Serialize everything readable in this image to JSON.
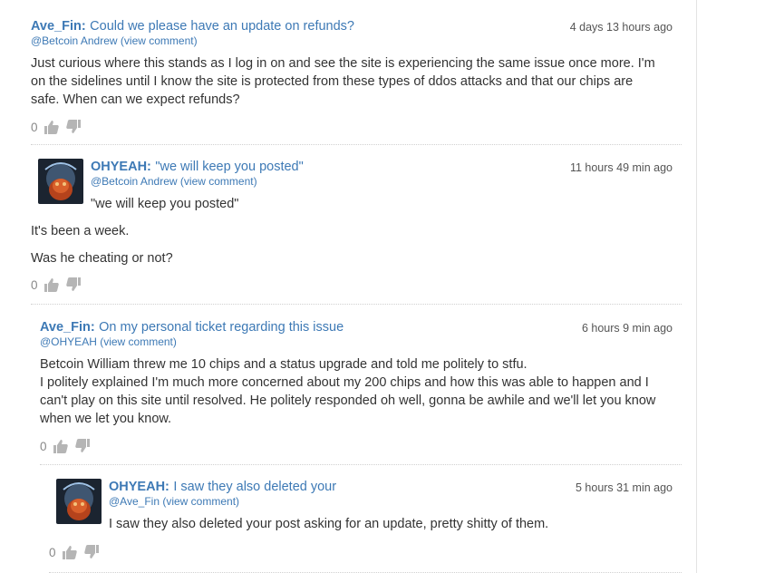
{
  "comments": [
    {
      "author": "Ave_Fin:",
      "subject": "Could we please have an update on refunds?",
      "mention": "@Betcoin Andrew",
      "view_link": "(view comment)",
      "time": "4 days 13 hours ago",
      "quote": "",
      "paragraphs": [
        "Just curious where this stands as I log in on and see the site is experiencing the same issue once more. I'm on the sidelines until I know the site is protected from these types of ddos attacks and that our chips are safe. When can we expect refunds?"
      ],
      "votes": "0"
    },
    {
      "author": "OHYEAH:",
      "subject": "\"we will keep you posted\"",
      "mention": "@Betcoin Andrew",
      "view_link": "(view comment)",
      "time": "11 hours 49 min ago",
      "quote": "\"we will keep you posted\"",
      "paragraphs": [
        "It's been a week.",
        "Was he cheating or not?"
      ],
      "votes": "0"
    },
    {
      "author": "Ave_Fin:",
      "subject": "On my personal ticket regarding this issue",
      "mention": "@OHYEAH",
      "view_link": "(view comment)",
      "time": "6 hours 9 min ago",
      "quote": "",
      "paragraphs": [
        "Betcoin William threw me 10 chips and a status upgrade and told me politely to stfu.",
        "I politely explained I'm much more concerned about my 200 chips and how this was able to happen and I can't play on this site until resolved. He politely responded oh well, gonna be awhile and we'll let you know when we let you know."
      ],
      "votes": "0"
    },
    {
      "author": "OHYEAH:",
      "subject": "I saw they also deleted your",
      "mention": "@Ave_Fin",
      "view_link": "(view comment)",
      "time": "5 hours 31 min ago",
      "quote": "",
      "paragraphs": [
        "I saw they also deleted your post asking for an update, pretty shitty of them."
      ],
      "votes": "0"
    }
  ],
  "icons": {
    "like": "thumbs-up-icon",
    "dislike": "thumbs-down-icon"
  },
  "colors": {
    "link": "#3d79b5",
    "text": "#333333",
    "muted": "#888888"
  }
}
